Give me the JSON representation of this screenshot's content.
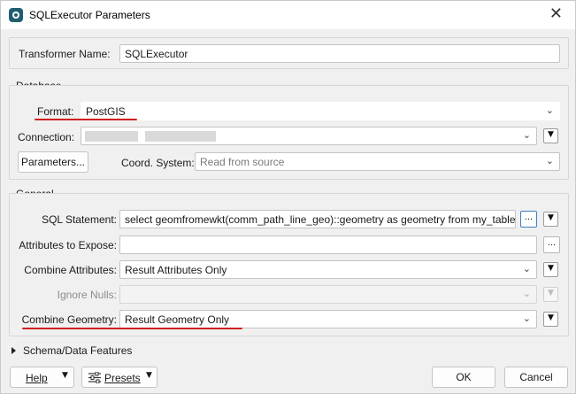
{
  "window": {
    "title": "SQLExecutor Parameters",
    "close_glyph": "✕"
  },
  "transformer": {
    "label": "Transformer Name:",
    "value": "SQLExecutor"
  },
  "database": {
    "group_title": "Database",
    "format": {
      "label": "Format:",
      "value": "PostGIS"
    },
    "connection": {
      "label": "Connection:",
      "value": ""
    },
    "parameters_button": "Parameters...",
    "coord_system": {
      "label": "Coord. System:",
      "value": "Read from source"
    }
  },
  "general": {
    "group_title": "General",
    "sql_statement": {
      "label": "SQL Statement:",
      "value": "select geomfromewkt(comm_path_line_geo)::geometry as geometry from my_table"
    },
    "attributes_to_expose": {
      "label": "Attributes to Expose:",
      "value": ""
    },
    "combine_attributes": {
      "label": "Combine Attributes:",
      "value": "Result Attributes Only"
    },
    "ignore_nulls": {
      "label": "Ignore Nulls:",
      "value": ""
    },
    "combine_geometry": {
      "label": "Combine Geometry:",
      "value": "Result Geometry Only"
    }
  },
  "schema_section": {
    "label": "Schema/Data Features"
  },
  "footer": {
    "help_label": "Help",
    "presets_label": "Presets",
    "ok_label": "OK",
    "cancel_label": "Cancel"
  },
  "glyphs": {
    "chevron": "⌄",
    "small_arrow": "▼",
    "ellipsis": "..."
  },
  "colors": {
    "annotation_underline": "#d11f1f",
    "app_icon": "#1f5d73",
    "focus_border": "#3e7fc1"
  }
}
